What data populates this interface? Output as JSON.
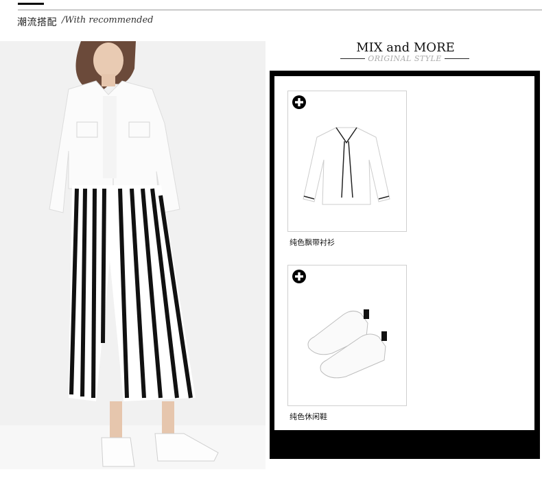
{
  "header": {
    "title": "潮流搭配",
    "subtitle": "/With recommended"
  },
  "mix": {
    "title": "MIX and MORE",
    "subtitle": "ORIGINAL STYLE"
  },
  "products": [
    {
      "label": "纯色飘带衬衫",
      "icon": "plus-circle-icon"
    },
    {
      "label": "纯色休闲鞋",
      "icon": "plus-circle-icon"
    }
  ],
  "colors": {
    "frame": "#000000",
    "background": "#ffffff",
    "subtitle_gray": "#aaaaaa"
  }
}
